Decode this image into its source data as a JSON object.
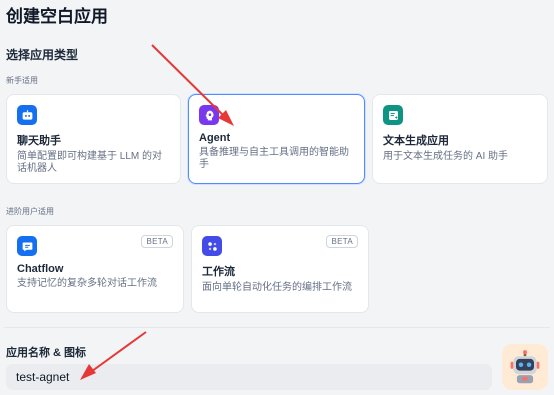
{
  "page": {
    "title": "创建空白应用"
  },
  "app_type": {
    "section_title": "选择应用类型",
    "beginner_label": "新手适用",
    "advanced_label": "进阶用户适用",
    "beginner_cards": [
      {
        "title": "聊天助手",
        "desc": "简单配置即可构建基于 LLM 的对话机器人",
        "icon": "chat-bot-icon",
        "color": "#1570ef"
      },
      {
        "title": "Agent",
        "desc": "具备推理与自主工具调用的智能助手",
        "icon": "agent-icon",
        "color": "#7839ee",
        "selected": true
      },
      {
        "title": "文本生成应用",
        "desc": "用于文本生成任务的 AI 助手",
        "icon": "text-generation-icon",
        "color": "#0e9384"
      }
    ],
    "advanced_cards": [
      {
        "title": "Chatflow",
        "desc": "支持记忆的复杂多轮对话工作流",
        "icon": "chatflow-icon",
        "color": "#1570ef",
        "badge": "BETA"
      },
      {
        "title": "工作流",
        "desc": "面向单轮自动化任务的编排工作流",
        "icon": "workflow-icon",
        "color": "#444ce7",
        "badge": "BETA"
      }
    ]
  },
  "app_name": {
    "label": "应用名称 & 图标",
    "value": "test-agnet"
  },
  "avatar": {
    "icon": "robot-avatar-icon",
    "bg": "#ffead5"
  },
  "annotations": {
    "arrow_color": "#e53935"
  }
}
